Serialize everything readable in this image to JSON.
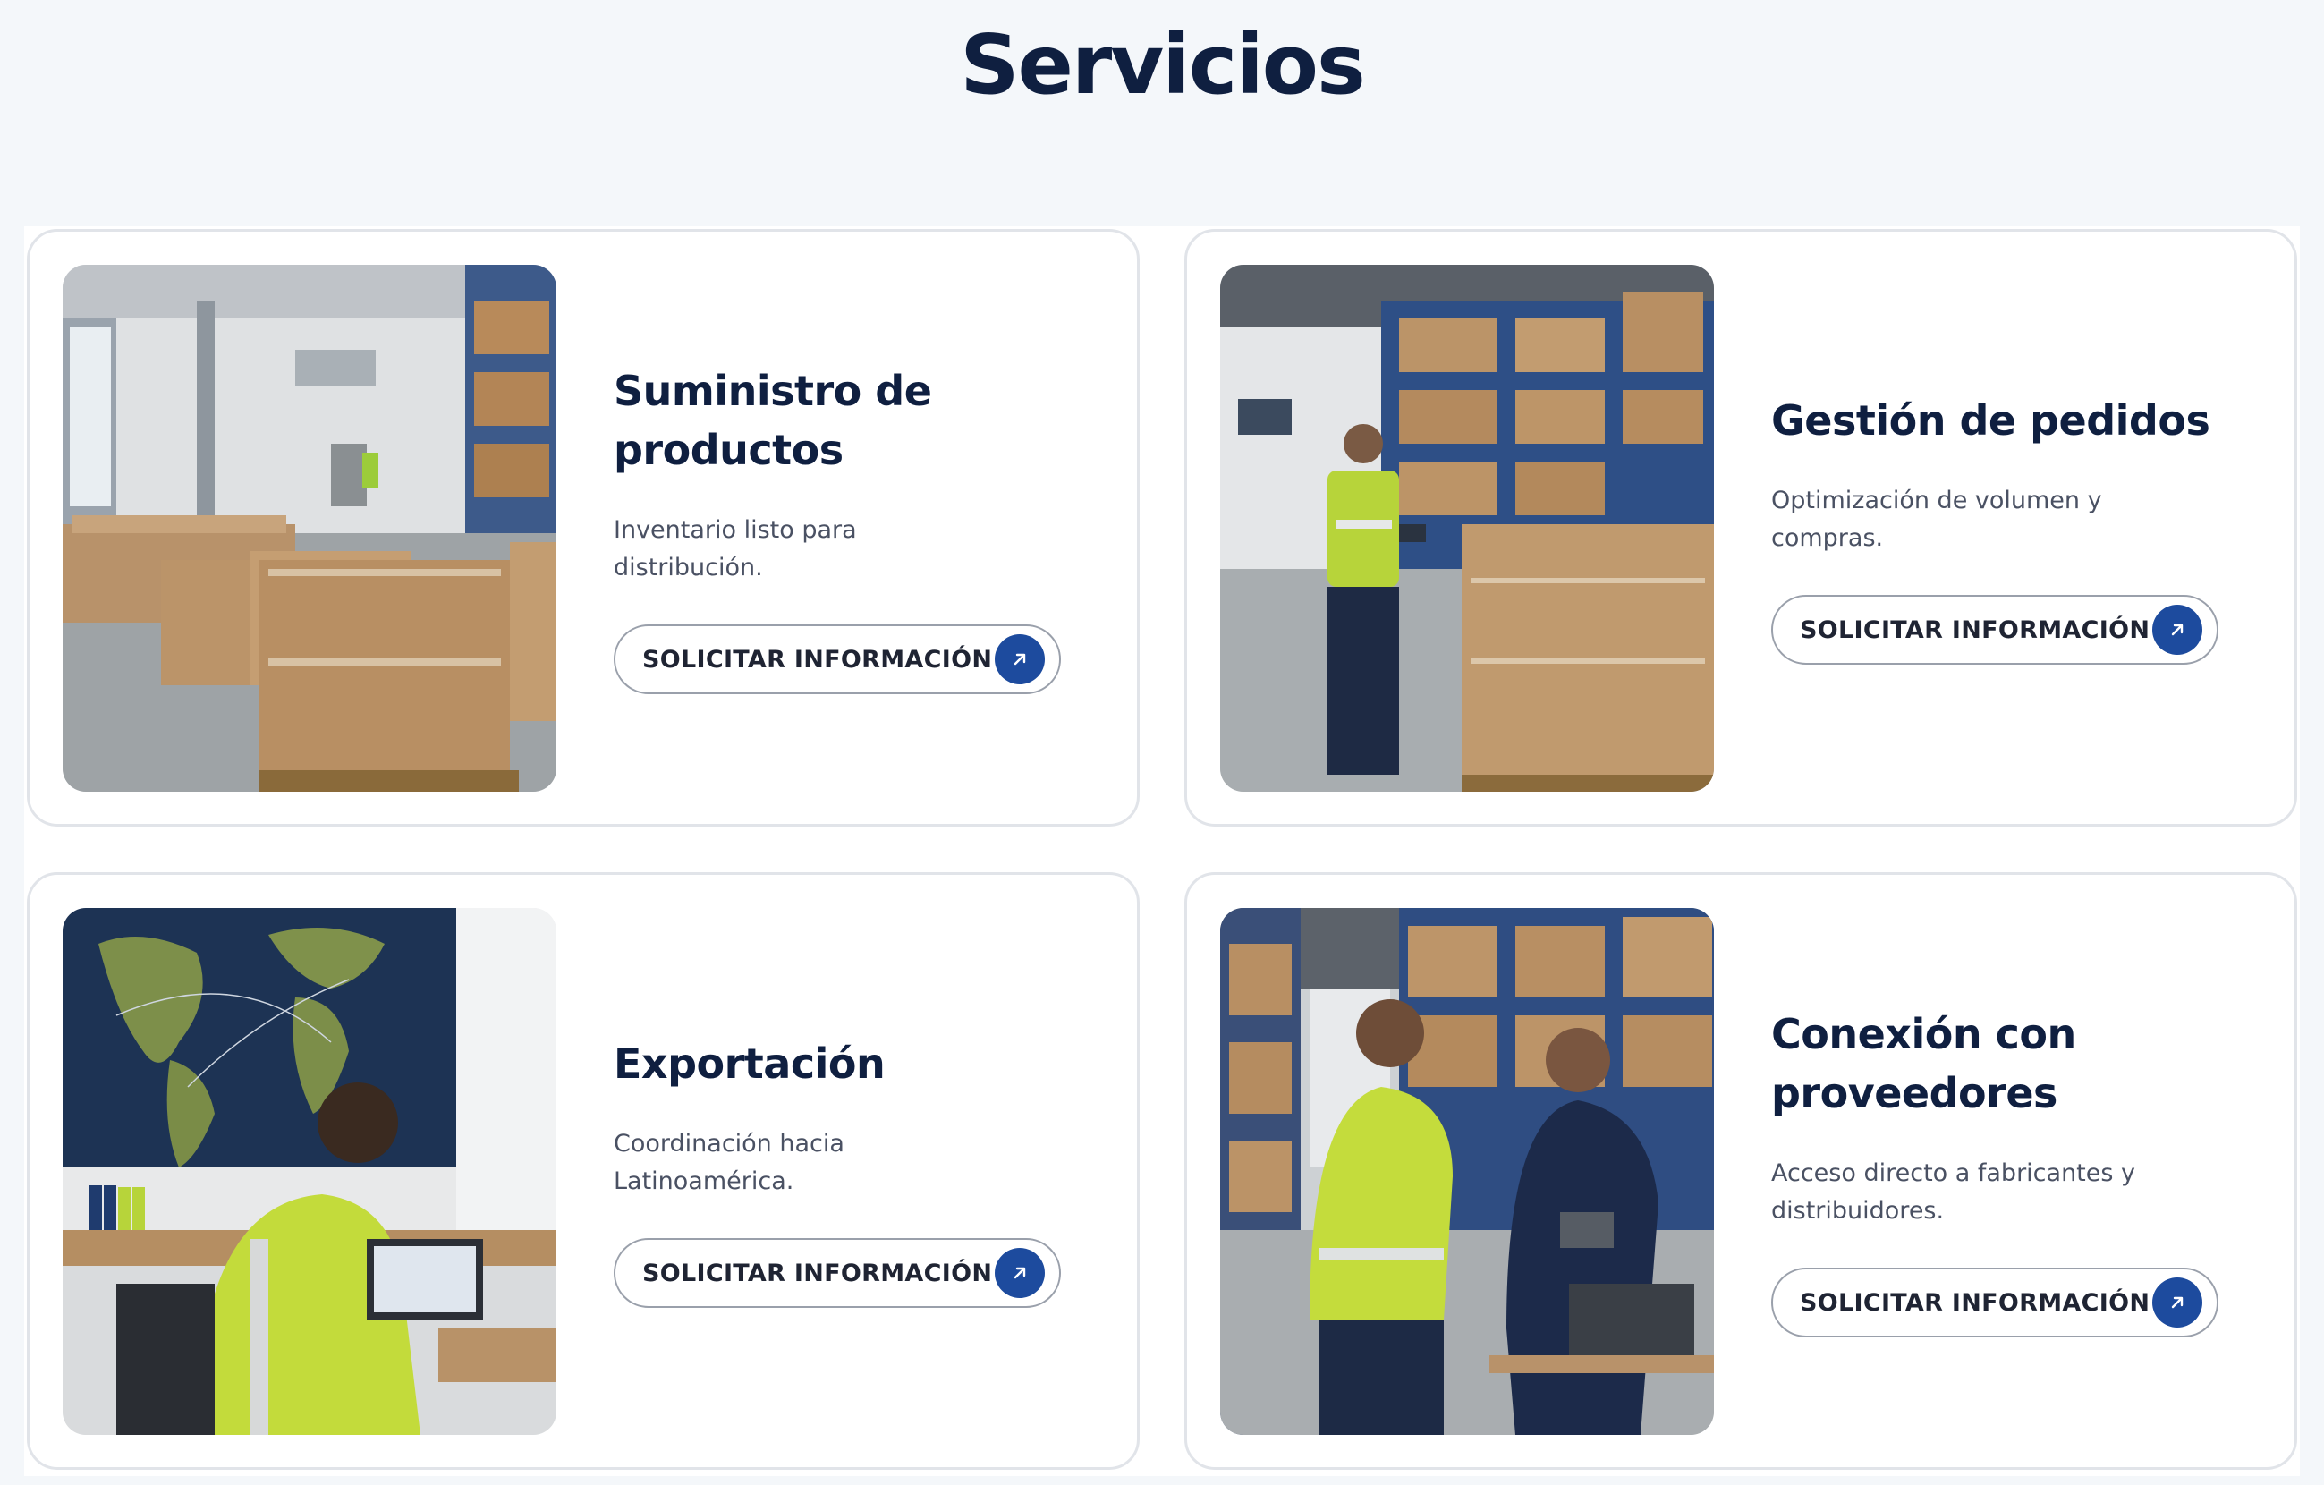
{
  "page": {
    "title": "Servicios"
  },
  "colors": {
    "accent": "#1d4b9e",
    "title": "#0f1f40",
    "border": "#e1e4e9",
    "background": "#f4f7fa"
  },
  "services": [
    {
      "title": "Suministro de productos",
      "description": "Inventario listo para distribución.",
      "cta_label": "SOLICITAR INFORMACIÓN",
      "cta_icon": "arrow-up-right-icon",
      "image": "warehouse-pallets-photo"
    },
    {
      "title": "Gestión de pedidos",
      "description": "Optimización de volumen y compras.",
      "cta_label": "SOLICITAR INFORMACIÓN",
      "cta_icon": "arrow-up-right-icon",
      "image": "warehouse-worker-tablet-photo"
    },
    {
      "title": "Exportación",
      "description": "Coordinación hacia Latinoamérica.",
      "cta_label": "SOLICITAR INFORMACIÓN",
      "cta_icon": "arrow-up-right-icon",
      "image": "office-world-map-photo"
    },
    {
      "title": "Conexión con proveedores",
      "description": "Acceso directo a fabricantes y distribuidores.",
      "cta_label": "SOLICITAR INFORMACIÓN",
      "cta_icon": "arrow-up-right-icon",
      "image": "handshake-warehouse-photo"
    }
  ]
}
